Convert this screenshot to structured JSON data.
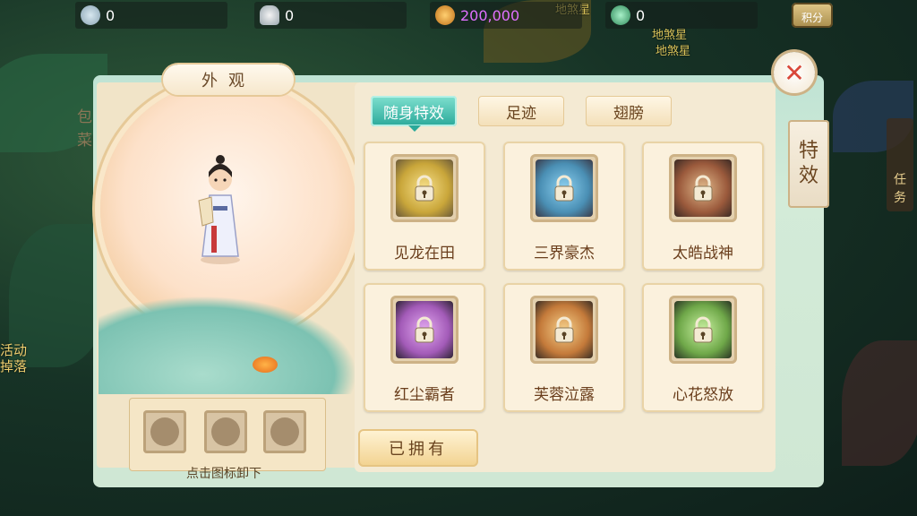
{
  "topbar": {
    "currency1": {
      "value": "0",
      "icon": "coin-silver-icon"
    },
    "currency2": {
      "value": "0",
      "icon": "silver-ingot-icon"
    },
    "currency3": {
      "value": "200,000",
      "icon": "copper-coin-icon",
      "color": "#e070ff"
    },
    "currency4": {
      "value": "0",
      "icon": "jade-add-icon"
    },
    "jifen_label": "积分"
  },
  "background": {
    "text1": "地煞星",
    "text2": "地煞星",
    "text3": "地煞星",
    "left_text1": "包",
    "left_text2": "菜",
    "left_text3": "活动",
    "left_text4": "掉落"
  },
  "appearance": {
    "title": "外观",
    "hint": "点击图标卸下",
    "slots": [
      "",
      "",
      ""
    ]
  },
  "tabs": [
    {
      "label": "随身特效",
      "active": true
    },
    {
      "label": "足迹",
      "active": false
    },
    {
      "label": "翅膀",
      "active": false
    }
  ],
  "effects": [
    {
      "name": "见龙在田",
      "locked": true,
      "color": "#c9a63a"
    },
    {
      "name": "三界豪杰",
      "locked": true,
      "color": "#4a8fb4"
    },
    {
      "name": "太皓战神",
      "locked": true,
      "color": "#9b5a3c"
    },
    {
      "name": "红尘霸者",
      "locked": true,
      "color": "#a35bb8"
    },
    {
      "name": "芙蓉泣露",
      "locked": true,
      "color": "#c47a3a"
    },
    {
      "name": "心花怒放",
      "locked": true,
      "color": "#6fa849"
    }
  ],
  "owned_button": "已拥有",
  "side_tab": {
    "line1": "特",
    "line2": "效"
  },
  "task_button": {
    "line1": "任",
    "line2": "务"
  },
  "colors": {
    "accent": "#2aa99a",
    "panel": "#f4ead3",
    "close": "#d9473a"
  }
}
